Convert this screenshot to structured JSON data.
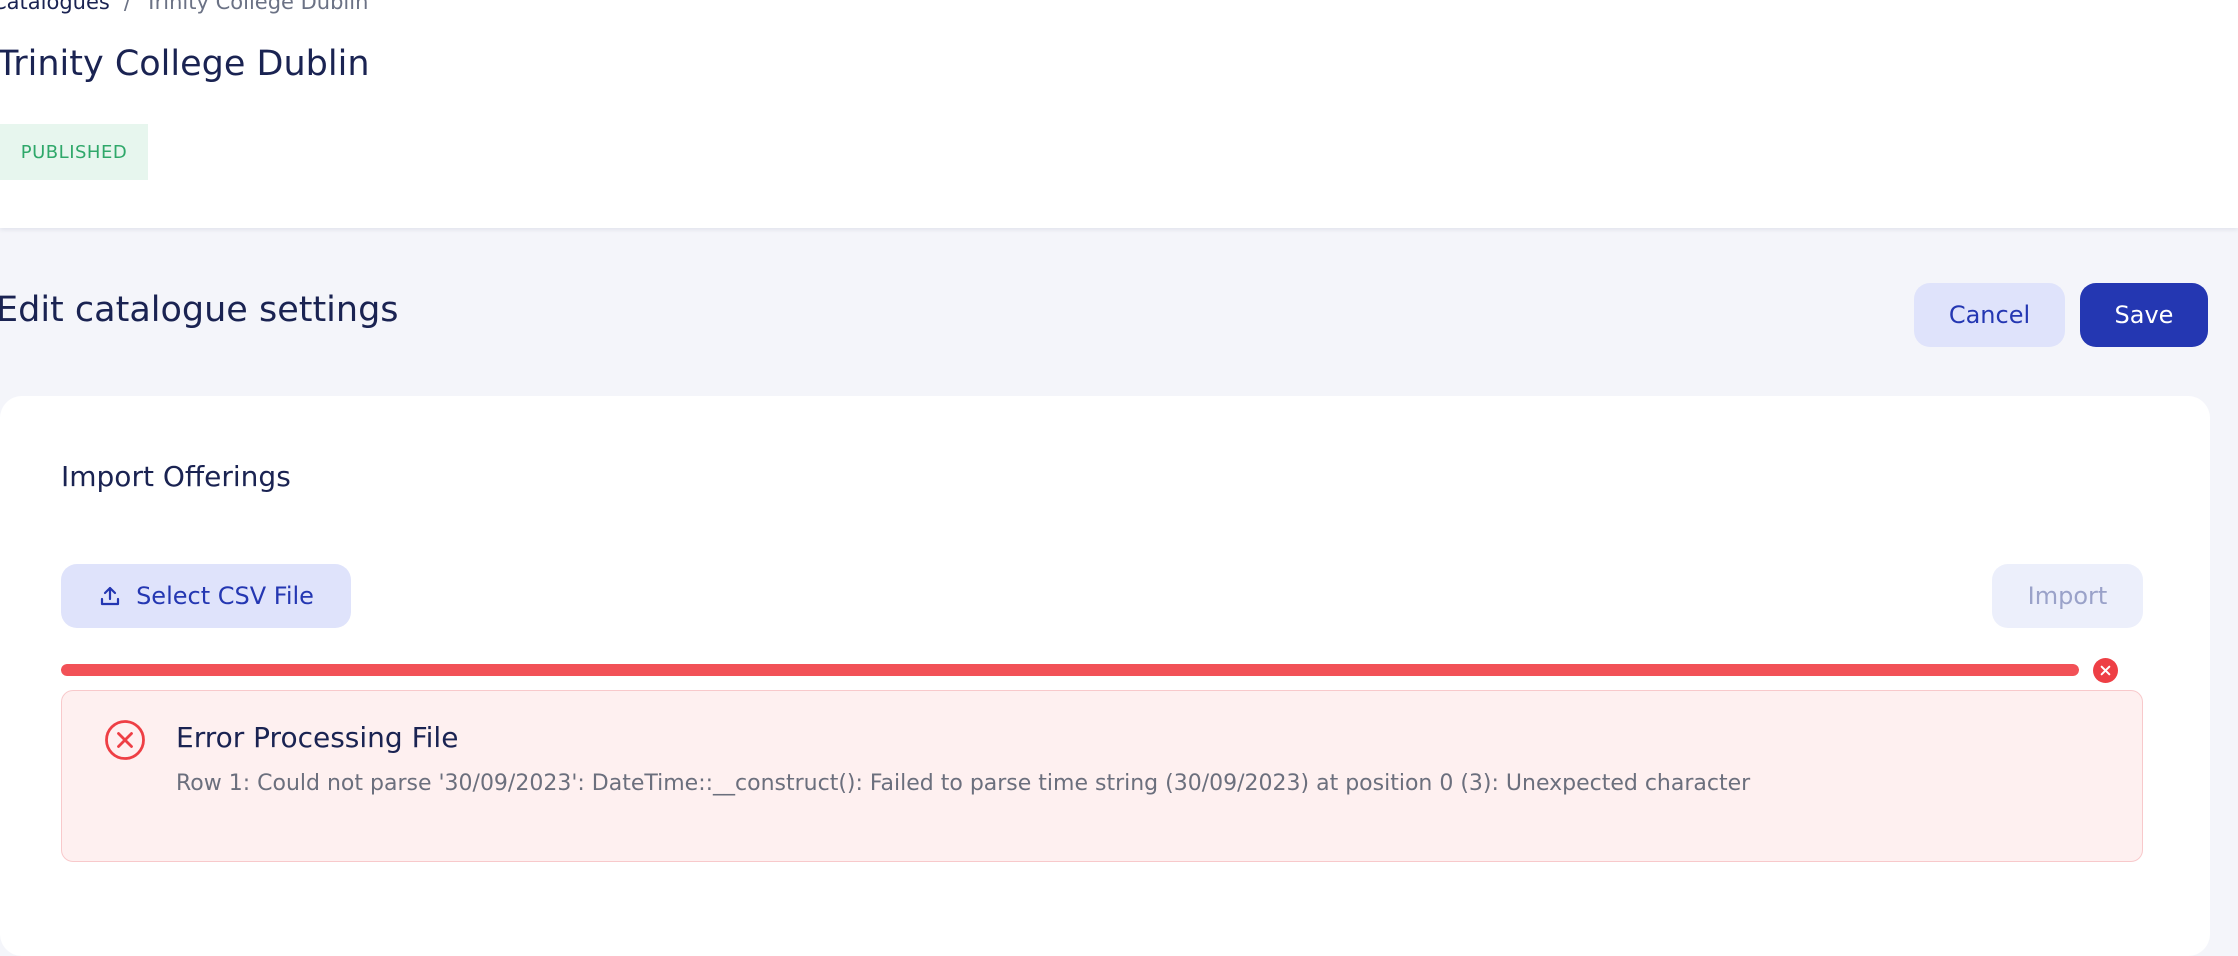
{
  "breadcrumb": {
    "parent": "Catalogues",
    "separator": "/",
    "current": "Trinity College Dublin"
  },
  "header": {
    "title": "Trinity College Dublin",
    "status": "PUBLISHED",
    "status_color": "#2fa86a"
  },
  "section": {
    "title": "Edit catalogue settings",
    "cancel_label": "Cancel",
    "save_label": "Save"
  },
  "import": {
    "title": "Import Offerings",
    "select_label": "Select CSV File",
    "select_icon": "upload-icon",
    "import_label": "Import",
    "progress_percent": 100,
    "progress_color": "#f25157",
    "clear_icon": "close-icon"
  },
  "error": {
    "icon": "error-circle-icon",
    "title": "Error Processing File",
    "message": "Row 1: Could not parse '30/09/2023': DateTime::__construct(): Failed to parse time string (30/09/2023) at position 0 (3): Unexpected character"
  },
  "colors": {
    "accent": "#2437b2",
    "error": "#ee3f45",
    "success": "#2fa86a"
  }
}
